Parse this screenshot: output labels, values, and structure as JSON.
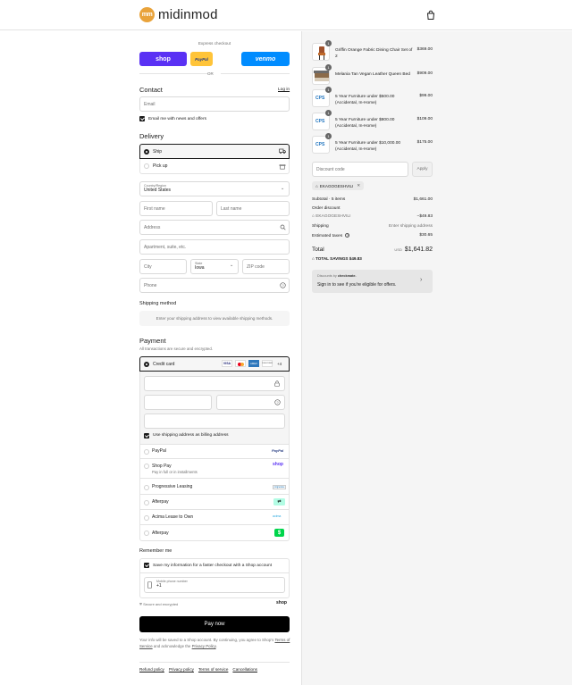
{
  "header": {
    "brand": "midinmod",
    "logo_mark": "mm"
  },
  "express": {
    "label": "Express checkout",
    "shop": "shop",
    "paypal": "PayPal",
    "venmo": "venmo",
    "or": "OR"
  },
  "contact": {
    "title": "Contact",
    "login": "Log in",
    "email_placeholder": "Email",
    "news_label": "Email me with news and offers"
  },
  "delivery": {
    "title": "Delivery",
    "ship": "Ship",
    "pickup": "Pick up",
    "country_label": "Country/Region",
    "country_value": "United States",
    "first_name": "First name",
    "last_name": "Last name",
    "address": "Address",
    "apartment": "Apartment, suite, etc.",
    "city": "City",
    "state_label": "State",
    "state_value": "Iowa",
    "zip": "ZIP code",
    "phone": "Phone"
  },
  "shipping_method": {
    "title": "Shipping method",
    "note": "Enter your shipping address to view available shipping methods."
  },
  "payment": {
    "title": "Payment",
    "subtitle": "All transactions are secure and encrypted.",
    "credit_card": "Credit card",
    "card_brands": [
      "VISA",
      "MC",
      "AMEX",
      "DISCOVER"
    ],
    "more": "+4",
    "billing_label": "Use shipping address as billing address",
    "methods": [
      {
        "label": "PayPal",
        "badge": "PayPal"
      },
      {
        "label": "Shop Pay",
        "sub": "Pay in full or in installments",
        "badge": "shop"
      },
      {
        "label": "Progressive Leasing",
        "badge": "progressive"
      },
      {
        "label": "Afterpay",
        "badge": "afterpay"
      },
      {
        "label": "Acima Lease to Own",
        "badge": "acima"
      },
      {
        "label": "Afterpay",
        "badge": "cash app"
      }
    ],
    "colors": {
      "shop": "#5a31f4",
      "paypal": "#ffc439",
      "venmo": "#008cff",
      "afterpay": "#b2fce4",
      "cashapp": "#00d54b"
    }
  },
  "remember": {
    "title": "Remember me",
    "save_label": "Save my information for a faster checkout with a Shop account",
    "phone_label": "Mobile phone number",
    "phone_value": "+1",
    "secure": "Secure and encrypted",
    "shop": "shop"
  },
  "pay_now": "Pay now",
  "legal": {
    "line1": "Your info will be saved to a Shop account. By continuing, you agree to Shop's",
    "terms": "Terms of Service",
    "and": "and acknowledge the",
    "privacy": "Privacy Policy",
    "end": "."
  },
  "footer": [
    "Refund policy",
    "Privacy policy",
    "Terms of service",
    "Cancellations"
  ],
  "order": {
    "items": [
      {
        "qty": "1",
        "name": "Griffin Orange Fabric Dining Chair Set of 2",
        "price": "$369.00",
        "thumb": "chair"
      },
      {
        "qty": "1",
        "name": "Melania Tan Vegan Leather Queen Bed",
        "price": "$909.00",
        "thumb": "bed"
      },
      {
        "qty": "1",
        "name": "5 Year Furniture under $500.00 (Accidental, In-Home)",
        "price": "$99.00",
        "thumb": "cps"
      },
      {
        "qty": "1",
        "name": "5 Year Furniture under $800.00 (Accidental, In-Home)",
        "price": "$109.00",
        "thumb": "cps"
      },
      {
        "qty": "1",
        "name": "5 Year Furniture under $10,000.00 (Accidental, In-Home)",
        "price": "$175.00",
        "thumb": "cps"
      }
    ],
    "discount_placeholder": "Discount code",
    "apply": "Apply",
    "code_tag": "EKAGOGESHVILI",
    "subtotal_label": "Subtotal · 5 items",
    "subtotal": "$1,661.00",
    "order_discount": "Order discount",
    "discount_code": "EKAGOGESHVILI",
    "discount_value": "−$49.83",
    "shipping_label": "Shipping",
    "shipping_value": "Enter shipping address",
    "taxes_label": "Estimated taxes",
    "taxes_value": "$30.65",
    "total_label": "Total",
    "currency": "USD",
    "total": "$1,641.82",
    "savings_label": "TOTAL SAVINGS",
    "savings_value": "$49.83",
    "offer_by": "Discounts by",
    "offer_brand": "checkmate.",
    "offer_text": "Sign in to see if you're eligible for offers."
  }
}
